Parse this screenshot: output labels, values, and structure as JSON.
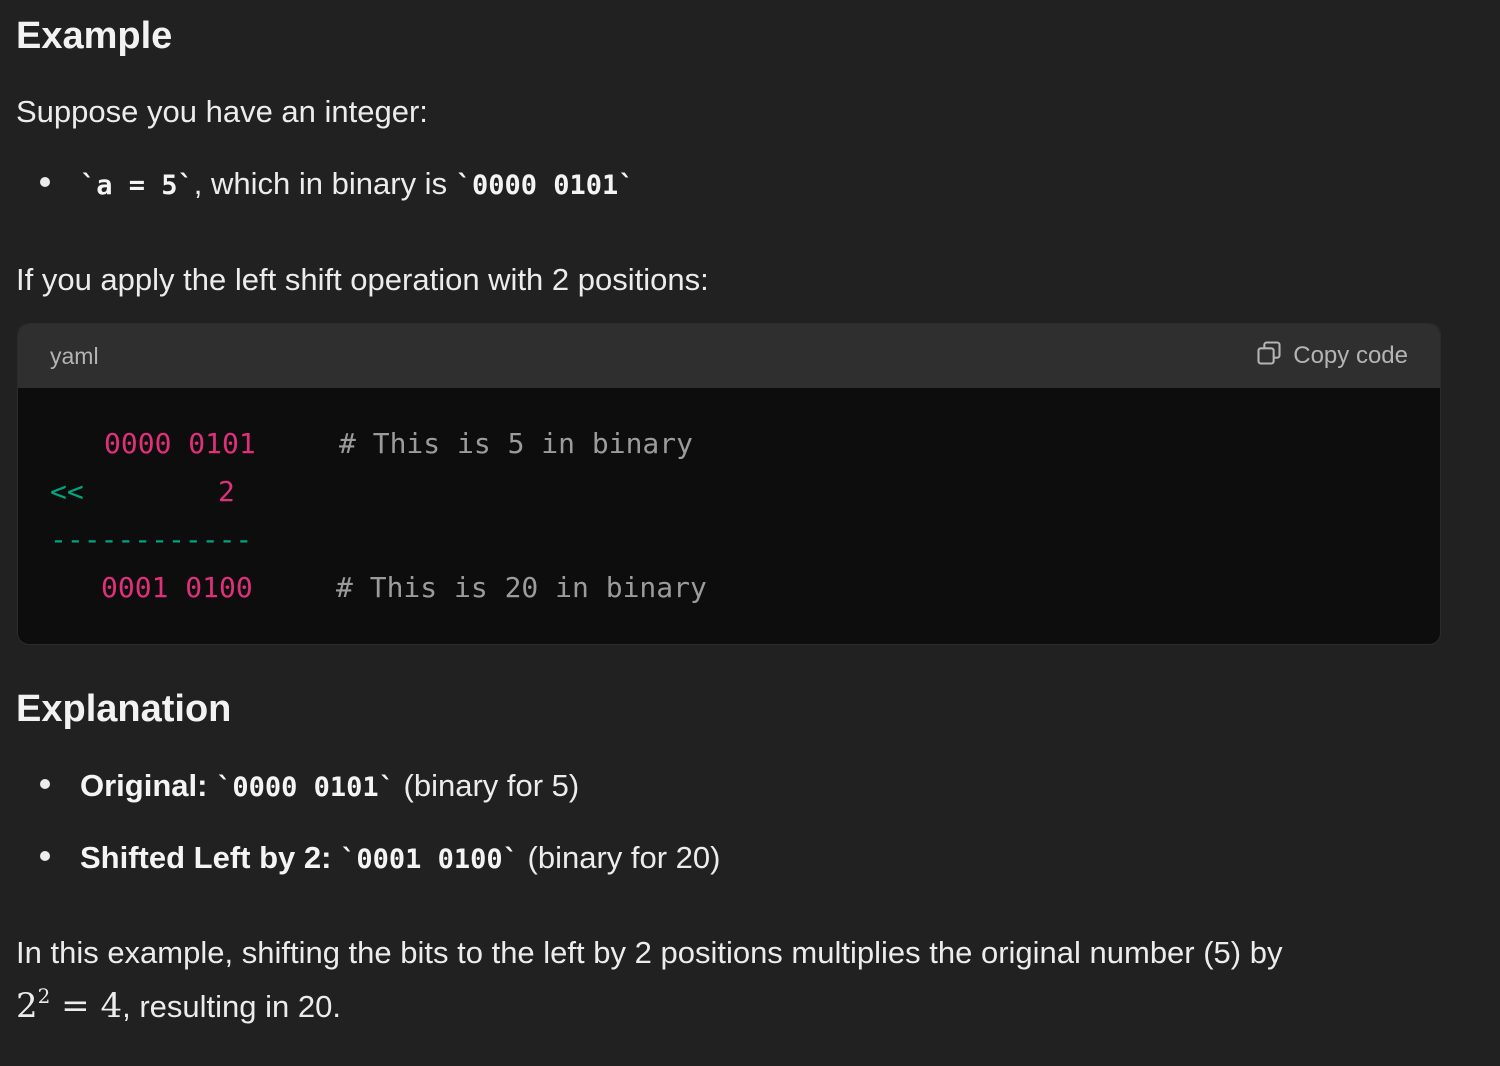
{
  "heading_example": "Example",
  "intro": "Suppose you have an integer:",
  "bullet1": {
    "code_a": "`a = 5`",
    "text": ", which in binary is ",
    "code_b": "`0000 0101`"
  },
  "shift_intro": "If you apply the left shift operation with 2 positions:",
  "codeblock": {
    "language": "yaml",
    "copy_label": "Copy code",
    "line1_value": "0000 0101",
    "line1_comment": "# This is 5 in binary",
    "line2_operator": "<<",
    "line2_value": "2",
    "line3_divider": "------------",
    "line4_value": "0001 0100",
    "line4_comment": "# This is 20 in binary"
  },
  "heading_explanation": "Explanation",
  "explanation": [
    {
      "label": "Original:",
      "code": "`0000 0101`",
      "note": "(binary for 5)"
    },
    {
      "label": "Shifted Left by 2:",
      "code": "`0001 0100`",
      "note": "(binary for 20)"
    }
  ],
  "conclusion": {
    "line1": "In this example, shifting the bits to the left by 2 positions multiplies the original number (5) by",
    "math_base": "2",
    "math_exp": "2",
    "math_rest": " = 4",
    "line2_rest": ", resulting in 20."
  }
}
